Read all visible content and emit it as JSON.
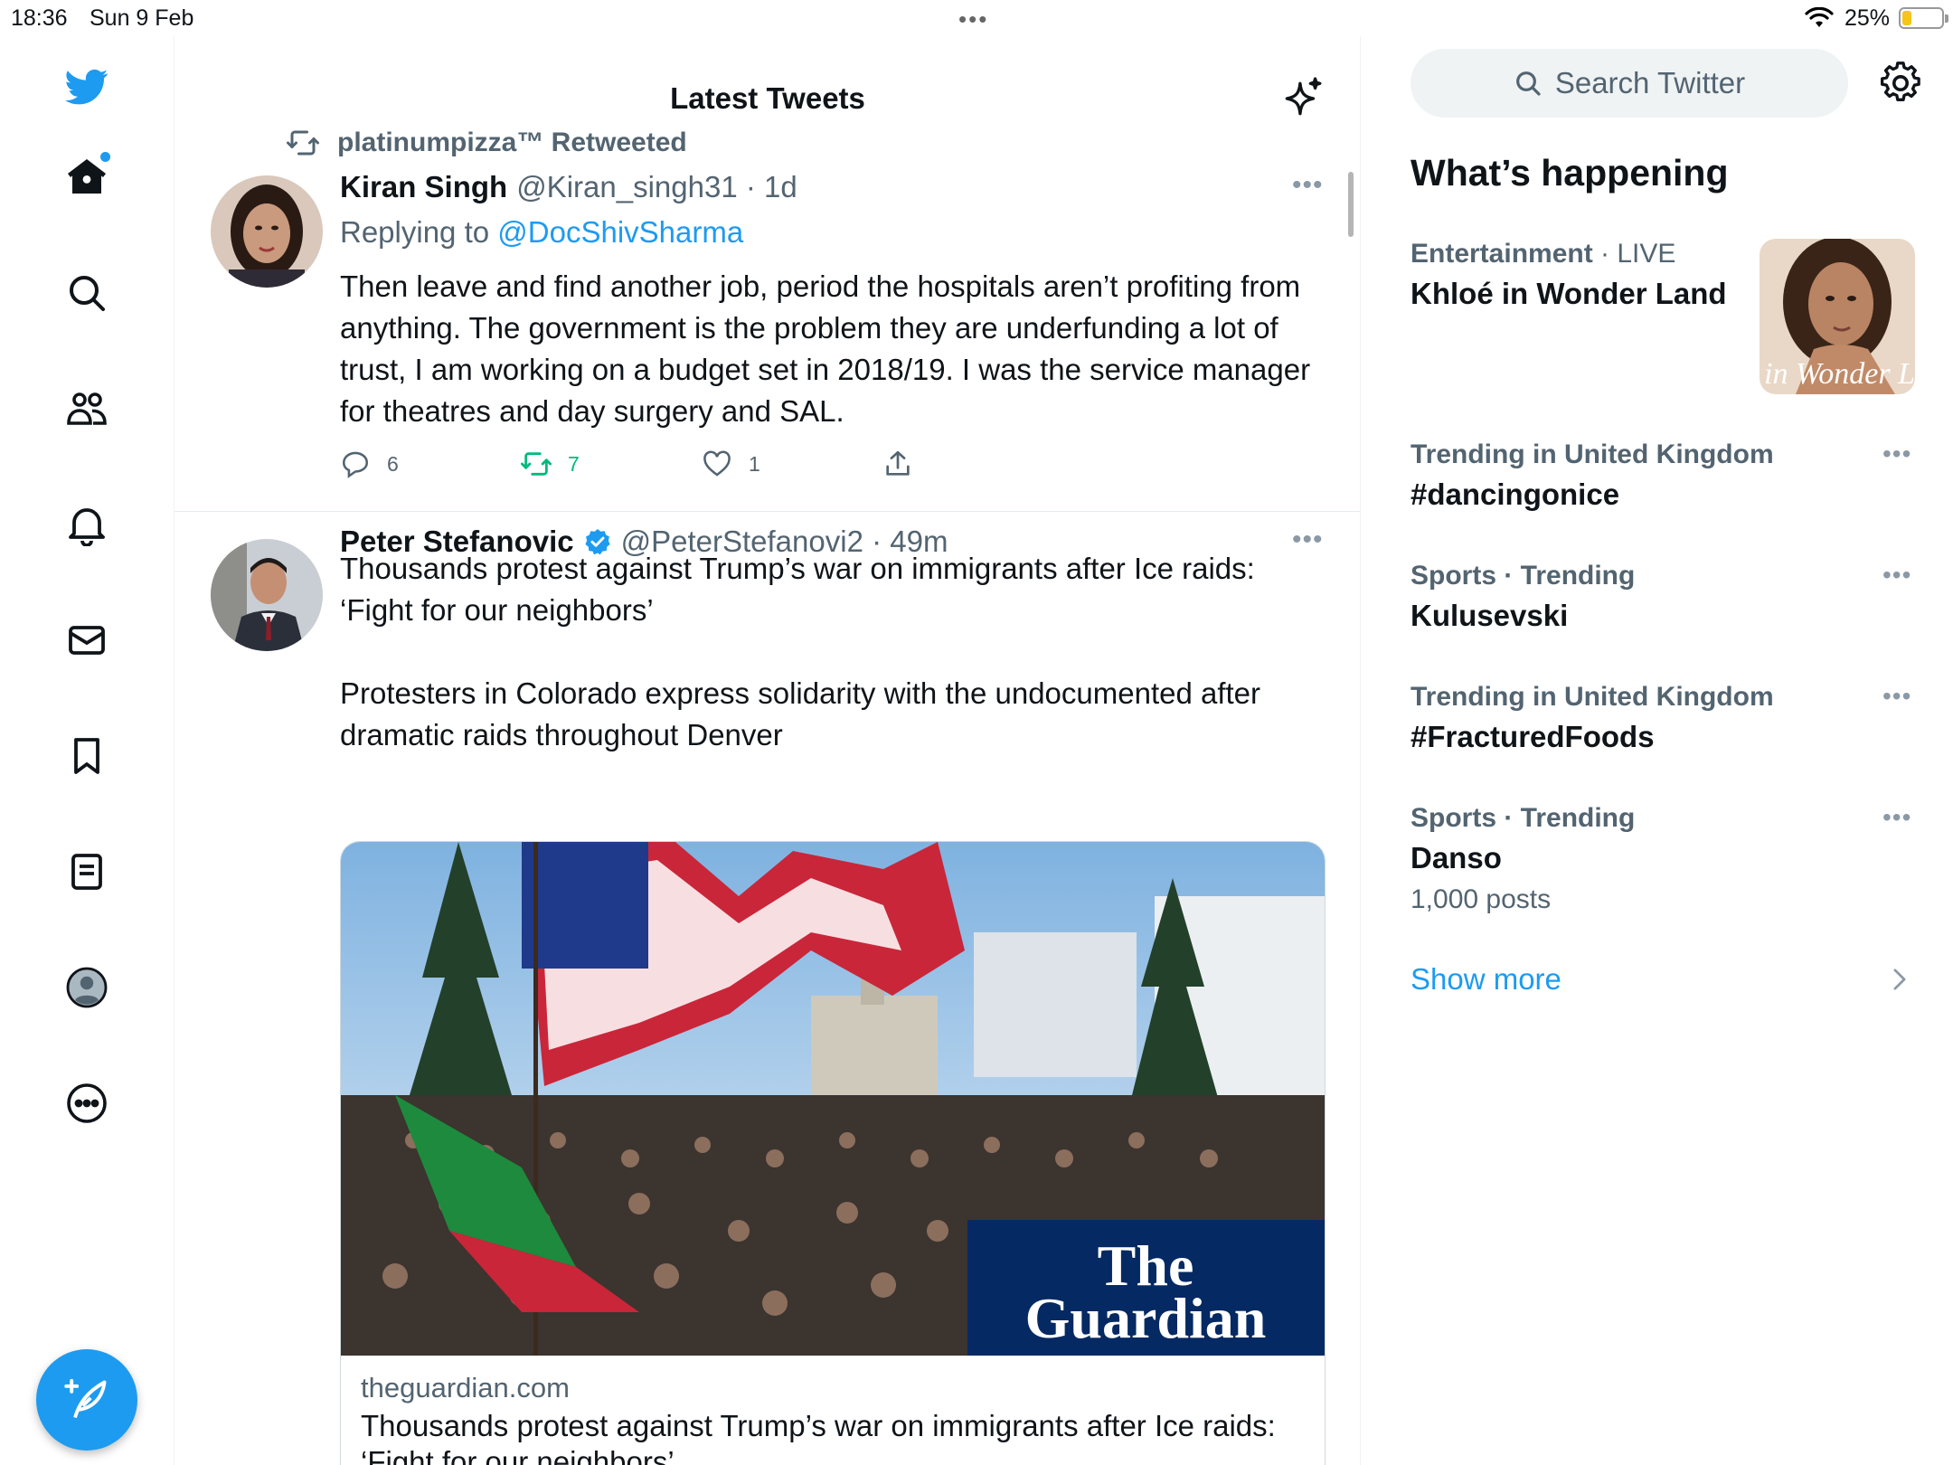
{
  "status_bar": {
    "time": "18:36",
    "date": "Sun 9 Feb",
    "battery": "25%",
    "battery_level": 0.25
  },
  "nav": {
    "items": [
      "home-icon",
      "search-icon",
      "communities-icon",
      "notifications-icon",
      "messages-icon",
      "bookmarks-icon",
      "lists-icon",
      "profile-icon",
      "more-icon"
    ],
    "compose_icon": "compose-icon",
    "accent": "#1d9bf0"
  },
  "timeline": {
    "title": "Latest Tweets",
    "tweets": [
      {
        "retweeted_by": "platinumpizza™ Retweeted",
        "name": "Kiran Singh",
        "handle_time": "@Kiran_singh31 · 1d",
        "replying_prefix": "Replying to",
        "replying_to": "@DocShivSharma",
        "text": "Then leave and find another job, period the hospitals aren’t profiting from anything. The government is the problem they are underfunding a lot of trust, I am working on a budget set in 2018/19. I was the service manager for theatres and day surgery and SAL.",
        "replies": "6",
        "retweets": "7",
        "likes": "1"
      },
      {
        "name": "Peter Stefanovic",
        "handle_time": "@PeterStefanovi2 · 49m",
        "text": "Thousands protest against Trump’s war on immigrants after Ice raids: ‘Fight for our neighbors’\n\nProtesters in Colorado express solidarity with the undocumented after dramatic raids throughout Denver",
        "card": {
          "domain": "theguardian.com",
          "title": "Thousands protest against Trump’s war on immigrants after Ice raids: ‘Fight for our neighbors’",
          "logo_text": "The Guardian"
        }
      }
    ]
  },
  "sidebar": {
    "search_placeholder": "Search Twitter",
    "section_title": "What’s happening",
    "trends": [
      {
        "category": "Entertainment",
        "extra": " · LIVE",
        "name": "Khloé in Wonder Land",
        "thumb_text": "é in Wonder L"
      },
      {
        "category": "Trending in United Kingdom",
        "extra": "",
        "name": "#dancingonice"
      },
      {
        "category": "Sports · Trending",
        "extra": "",
        "name": "Kulusevski"
      },
      {
        "category": "Trending in United Kingdom",
        "extra": "",
        "name": "#FracturedFoods"
      },
      {
        "category": "Sports · Trending",
        "extra": "",
        "name": "Danso",
        "count": "1,000 posts"
      }
    ],
    "show_more": "Show more"
  }
}
